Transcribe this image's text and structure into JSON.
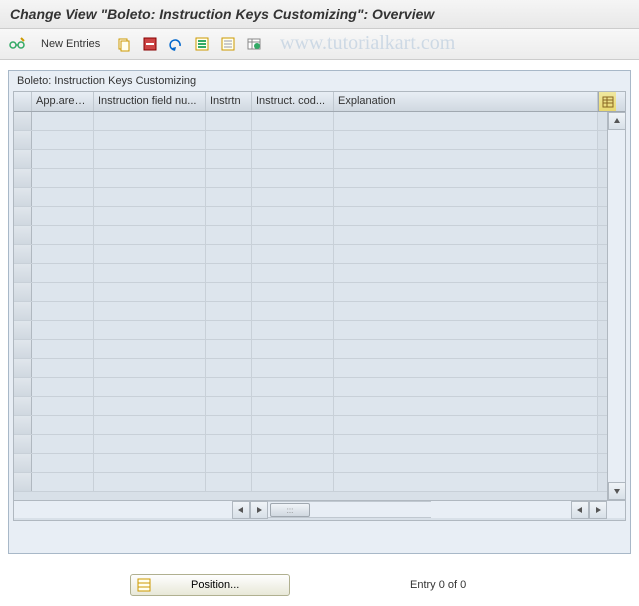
{
  "title": "Change View \"Boleto: Instruction Keys Customizing\": Overview",
  "watermark": "www.tutorialkart.com",
  "toolbar": {
    "new_entries_label": "New Entries"
  },
  "panel": {
    "title": "Boleto: Instruction Keys Customizing"
  },
  "columns": [
    "App.area...",
    "Instruction field nu...",
    "Instrtn",
    "Instruct. cod...",
    "Explanation"
  ],
  "footer": {
    "position_label": "Position...",
    "entry_text": "Entry 0 of 0"
  }
}
